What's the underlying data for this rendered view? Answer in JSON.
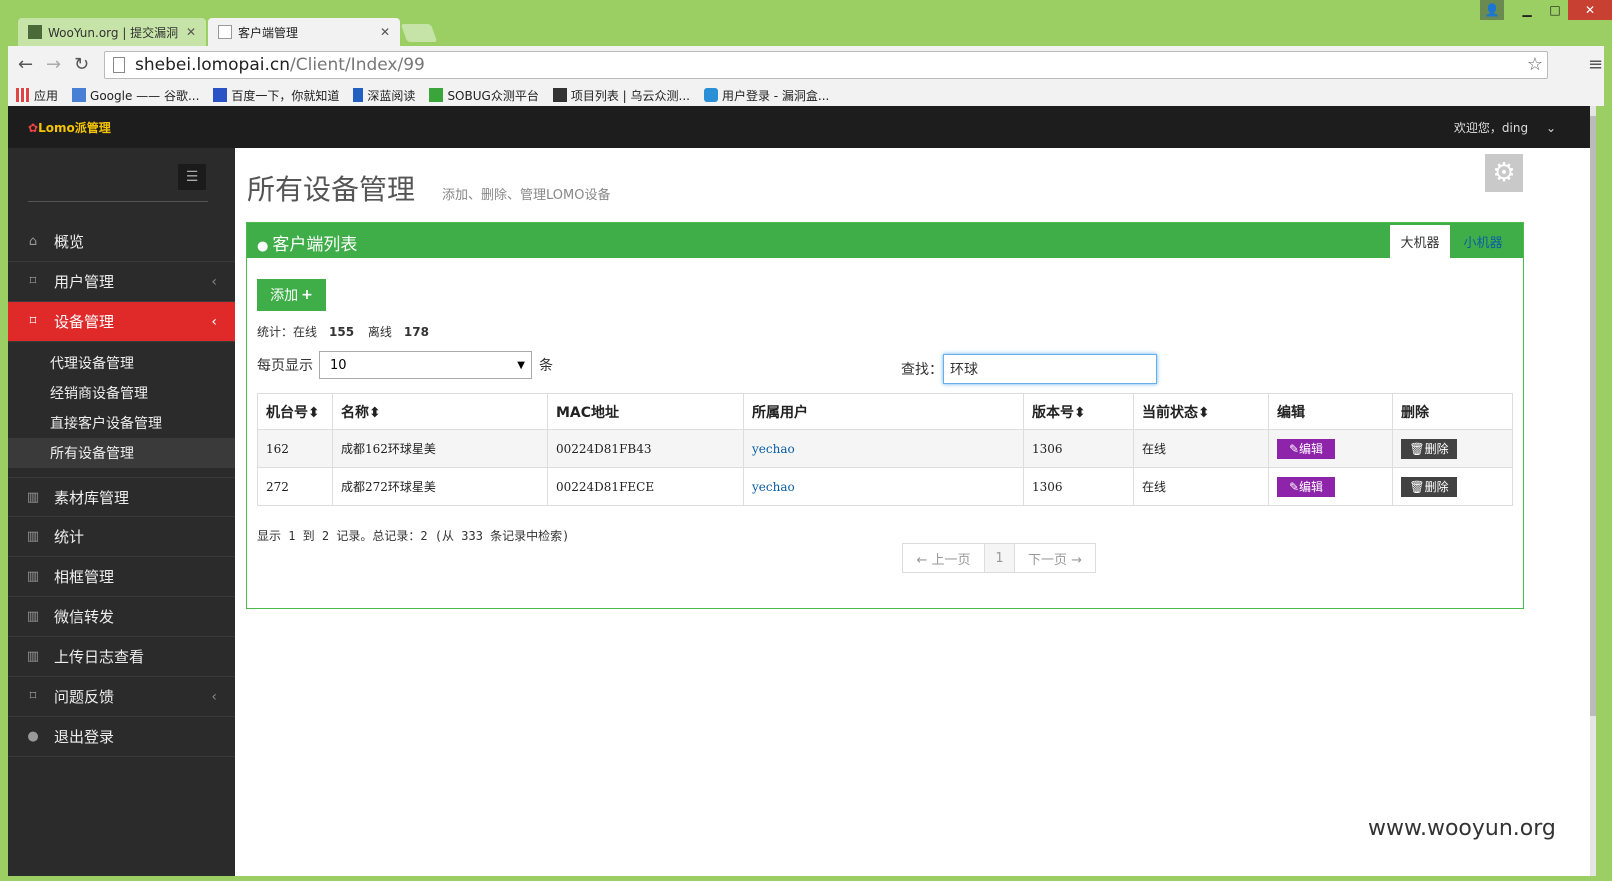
{
  "browser": {
    "tabs": [
      {
        "label": "WooYun.org | 提交漏洞"
      },
      {
        "label": "客户端管理"
      }
    ],
    "url_host": "shebei.lomopai.cn",
    "url_path": "/Client/Index/99",
    "bookmarks": [
      {
        "label": "应用",
        "color": "#e04444"
      },
      {
        "label": "Google —— 谷歌...",
        "color": "#4a7fd6"
      },
      {
        "label": "百度一下，你就知道",
        "color": "#2b52c4"
      },
      {
        "label": "深蓝阅读",
        "color": "#2060c0"
      },
      {
        "label": "SOBUG众测平台",
        "color": "#3aa53a"
      },
      {
        "label": "项目列表 | 乌云众测...",
        "color": "#333333"
      },
      {
        "label": "用户登录 - 漏洞盒...",
        "color": "#2a8fd6"
      }
    ]
  },
  "header": {
    "logo": "Lomo派管理",
    "welcome": "欢迎您，ding"
  },
  "sidebar": {
    "items": [
      {
        "label": "概览",
        "icon": "home-icon"
      },
      {
        "label": "用户管理",
        "icon": "bookmark-icon"
      },
      {
        "label": "设备管理",
        "icon": "bookmark-icon"
      },
      {
        "label": "素材库管理",
        "icon": "chart-icon"
      },
      {
        "label": "统计",
        "icon": "chart-icon"
      },
      {
        "label": "相框管理",
        "icon": "chart-icon"
      },
      {
        "label": "微信转发",
        "icon": "chart-icon"
      },
      {
        "label": "上传日志查看",
        "icon": "chart-icon"
      },
      {
        "label": "问题反馈",
        "icon": "bookmark-icon"
      },
      {
        "label": "退出登录",
        "icon": "user-icon"
      }
    ],
    "subitems": [
      {
        "label": "代理设备管理"
      },
      {
        "label": "经销商设备管理"
      },
      {
        "label": "直接客户设备管理"
      },
      {
        "label": "所有设备管理"
      }
    ]
  },
  "main": {
    "title": "所有设备管理",
    "subtitle": "添加、删除、管理LOMO设备",
    "box_title": "客户端列表",
    "tab_big": "大机器",
    "tab_small": "小机器",
    "add_label": "添加",
    "stats": {
      "label": "统计：在线",
      "online": "155",
      "offline_label": "离线",
      "offline": "178"
    },
    "perpage_label": "每页显示",
    "perpage_value": "10",
    "perpage_unit": "条",
    "search_label": "查找：",
    "search_value": "环球",
    "table": {
      "headers": [
        "机台号",
        "名称",
        "MAC地址",
        "所属用户",
        "版本号",
        "当前状态",
        "编辑",
        "删除"
      ],
      "rows": [
        {
          "id": "162",
          "name": "成都162环球星美",
          "mac": "00224D81FB43",
          "user": "yechao",
          "version": "1306",
          "status": "在线",
          "edit": "编辑",
          "delete": "删除"
        },
        {
          "id": "272",
          "name": "成都272环球星美",
          "mac": "00224D81FECE",
          "user": "yechao",
          "version": "1306",
          "status": "在线",
          "edit": "编辑",
          "delete": "删除"
        }
      ]
    },
    "info": "显示 1 到 2 记录。总记录：2 (从 333 条记录中检索)",
    "pager": {
      "prev": "← 上一页",
      "current": "1",
      "next": "下一页 →"
    }
  },
  "watermark": "www.wooyun.org"
}
